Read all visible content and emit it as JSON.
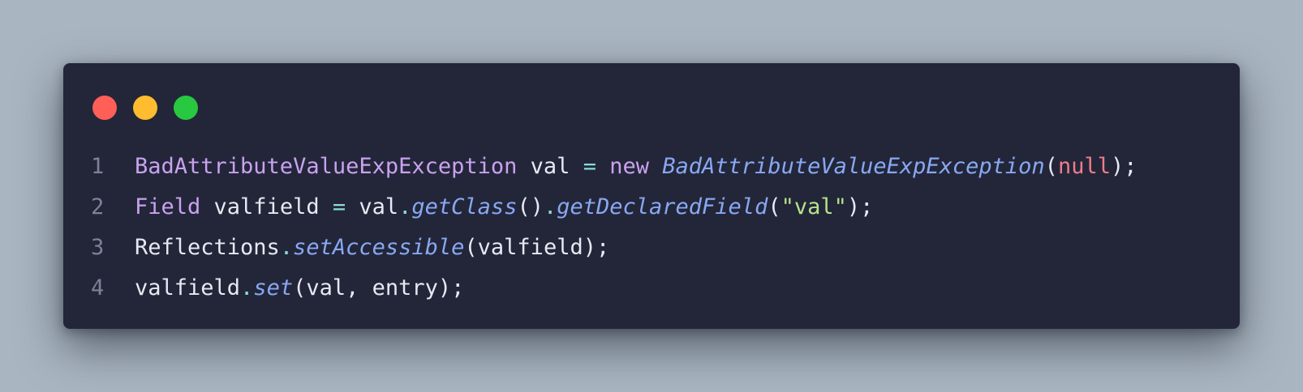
{
  "theme": {
    "background": "#a9b5c0",
    "window_bg": "#232639",
    "dot_close": "#ff5f57",
    "dot_minimize": "#febc2e",
    "dot_zoom": "#28c840",
    "line_number": "#7d8296",
    "plain": "#e7e9f2",
    "type": "#c9a2f0",
    "keyword": "#c9a2f0",
    "operator": "#89ddd6",
    "method": "#88a8f2",
    "string": "#b5e38b",
    "null": "#f07c8a",
    "punct": "#e7e9f2"
  },
  "window_controls": [
    {
      "name": "close",
      "icon": "red-circle"
    },
    {
      "name": "minimize",
      "icon": "yellow-circle"
    },
    {
      "name": "zoom",
      "icon": "green-circle"
    }
  ],
  "code": {
    "lines": [
      {
        "number": "1",
        "tokens": [
          {
            "text": "BadAttributeValueExpException",
            "kind": "type"
          },
          {
            "text": " val ",
            "kind": "plain"
          },
          {
            "text": "=",
            "kind": "operator"
          },
          {
            "text": " ",
            "kind": "plain"
          },
          {
            "text": "new",
            "kind": "keyword"
          },
          {
            "text": " ",
            "kind": "plain"
          },
          {
            "text": "BadAttributeValueExpException",
            "kind": "method",
            "italic": true
          },
          {
            "text": "(",
            "kind": "punct"
          },
          {
            "text": "null",
            "kind": "null"
          },
          {
            "text": ");",
            "kind": "punct"
          }
        ]
      },
      {
        "number": "2",
        "tokens": [
          {
            "text": "Field",
            "kind": "type"
          },
          {
            "text": " valfield ",
            "kind": "plain"
          },
          {
            "text": "=",
            "kind": "operator"
          },
          {
            "text": " val",
            "kind": "plain"
          },
          {
            "text": ".",
            "kind": "operator"
          },
          {
            "text": "getClass",
            "kind": "method",
            "italic": true
          },
          {
            "text": "()",
            "kind": "punct"
          },
          {
            "text": ".",
            "kind": "operator"
          },
          {
            "text": "getDeclaredField",
            "kind": "method",
            "italic": true
          },
          {
            "text": "(",
            "kind": "punct"
          },
          {
            "text": "\"val\"",
            "kind": "string"
          },
          {
            "text": ");",
            "kind": "punct"
          }
        ]
      },
      {
        "number": "3",
        "tokens": [
          {
            "text": "Reflections",
            "kind": "plain"
          },
          {
            "text": ".",
            "kind": "operator"
          },
          {
            "text": "setAccessible",
            "kind": "method",
            "italic": true
          },
          {
            "text": "(valfield);",
            "kind": "punct"
          }
        ]
      },
      {
        "number": "4",
        "tokens": [
          {
            "text": "valfield",
            "kind": "plain"
          },
          {
            "text": ".",
            "kind": "operator"
          },
          {
            "text": "set",
            "kind": "method",
            "italic": true
          },
          {
            "text": "(val, entry);",
            "kind": "punct"
          }
        ]
      }
    ]
  }
}
